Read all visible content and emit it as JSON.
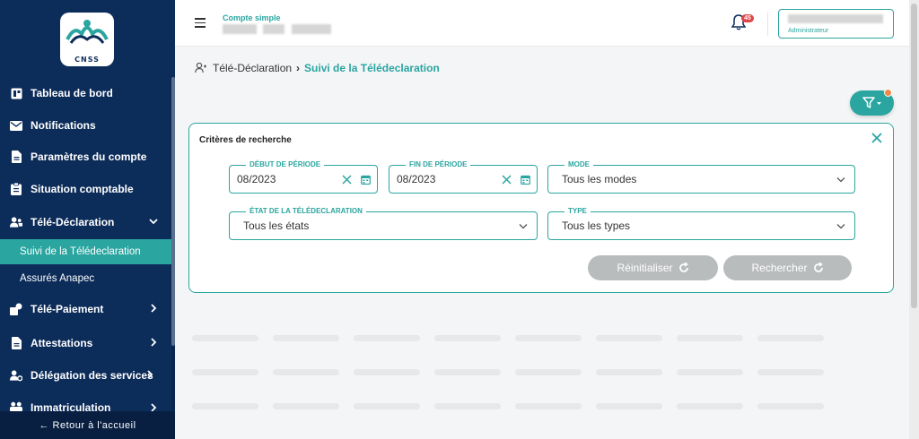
{
  "sidebar": {
    "logo_text": "CNSS",
    "items": [
      {
        "label": "Tableau de bord"
      },
      {
        "label": "Notifications"
      },
      {
        "label": "Paramètres du compte"
      },
      {
        "label": "Situation comptable"
      },
      {
        "label": "Télé-Déclaration"
      },
      {
        "label": "Télé-Paiement"
      },
      {
        "label": "Attestations"
      },
      {
        "label": "Délégation des services"
      },
      {
        "label": "Immatriculation"
      }
    ],
    "sub_items": [
      {
        "label": "Suivi de la Télédeclaration"
      },
      {
        "label": "Assurés Anapec"
      }
    ],
    "return_label": "← Retour à l'accueil"
  },
  "header": {
    "account_type": "Compte simple",
    "notification_count": "45",
    "user_role": "Administrateur"
  },
  "breadcrumb": {
    "parent": "Télé-Déclaration",
    "current": "Suivi de la Télédeclaration"
  },
  "panel": {
    "title": "Critères de recherche",
    "fields": {
      "start": {
        "label": "Début de période",
        "value": "08/2023"
      },
      "end": {
        "label": "Fin de période",
        "value": "08/2023"
      },
      "mode": {
        "label": "Mode",
        "value": "Tous les modes"
      },
      "state": {
        "label": "État de la télédeclaration",
        "value": "Tous les états"
      },
      "type": {
        "label": "Type",
        "value": "Tous les types"
      }
    },
    "reset_label": "Réinitialiser",
    "search_label": "Rechercher"
  },
  "colors": {
    "sidebar": "#0c2c5a",
    "accent": "#2aa5a0",
    "badge": "#e04545",
    "filter_dot": "#f08a45",
    "button_disabled": "#b9bcbd"
  }
}
